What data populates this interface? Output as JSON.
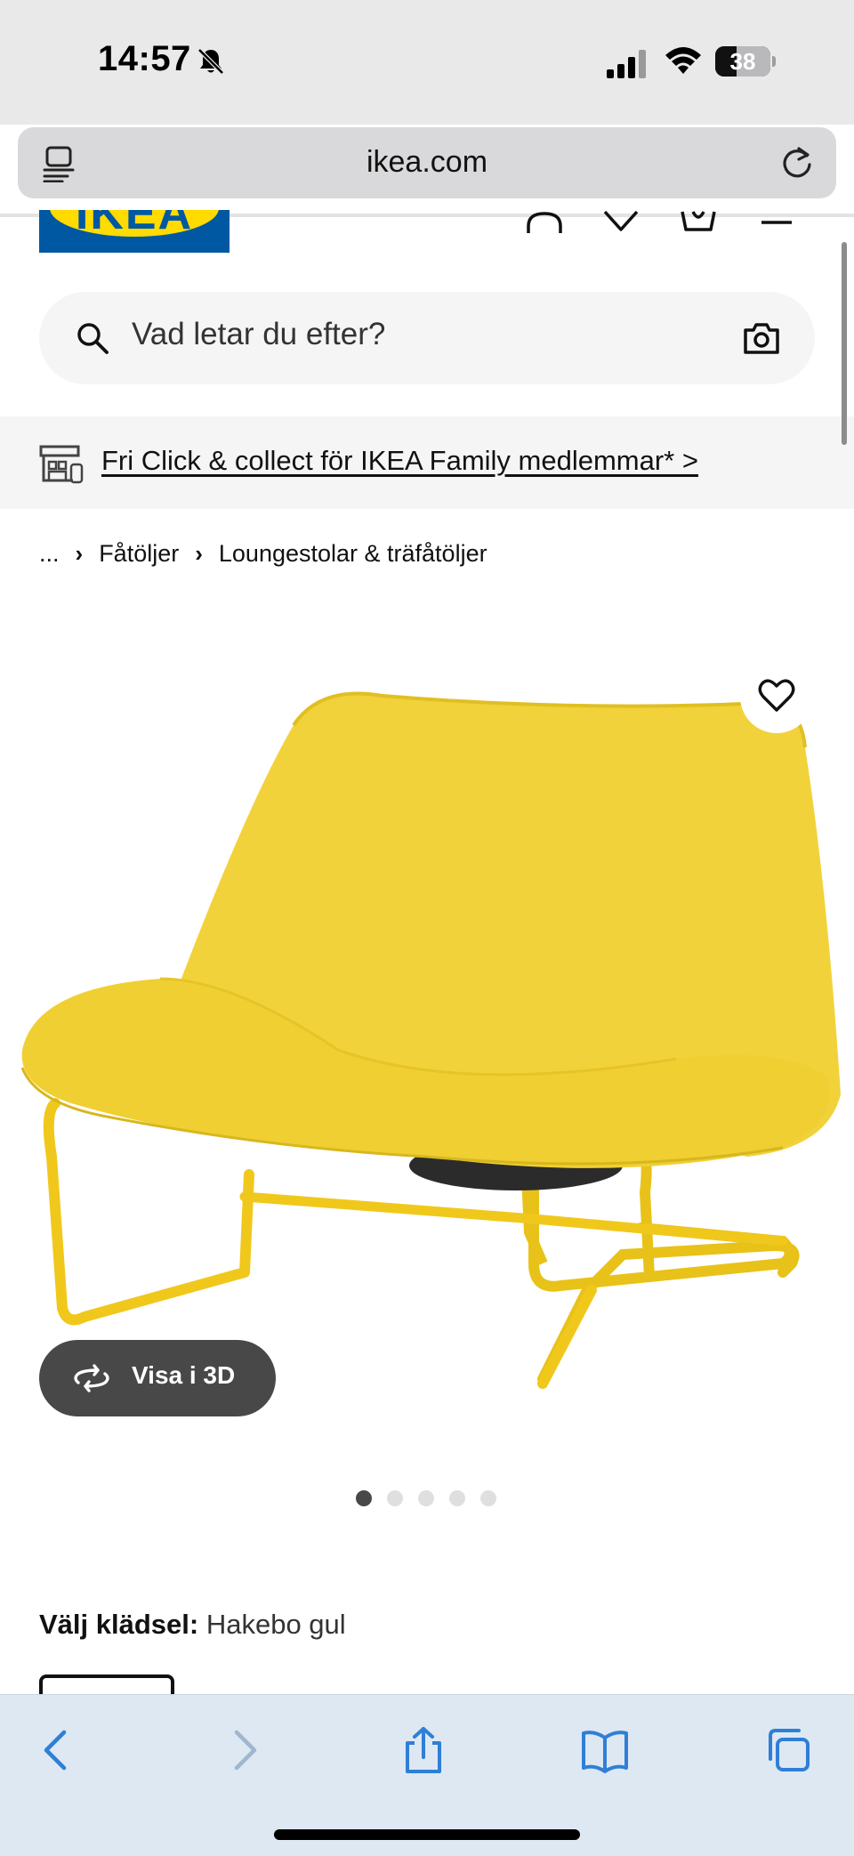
{
  "status_bar": {
    "time": "14:57",
    "battery_level": "38"
  },
  "browser": {
    "url": "ikea.com"
  },
  "header": {
    "logo_text": "IKEA"
  },
  "search": {
    "placeholder": "Vad letar du efter?"
  },
  "promo": {
    "text": "Fri Click & collect för IKEA Family medlemmar* >"
  },
  "breadcrumb": {
    "items": [
      "...",
      "Fåtöljer",
      "Loungestolar & träfåtöljer"
    ]
  },
  "product": {
    "view_3d_label": "Visa i 3D",
    "image_count": 5,
    "active_image_index": 0,
    "upholstery_label": "Välj klädsel:",
    "upholstery_value": "Hakebo gul"
  },
  "colors": {
    "ikea_blue": "#0058a3",
    "ikea_yellow": "#ffdb00",
    "chair_yellow": "#f2d23a"
  }
}
